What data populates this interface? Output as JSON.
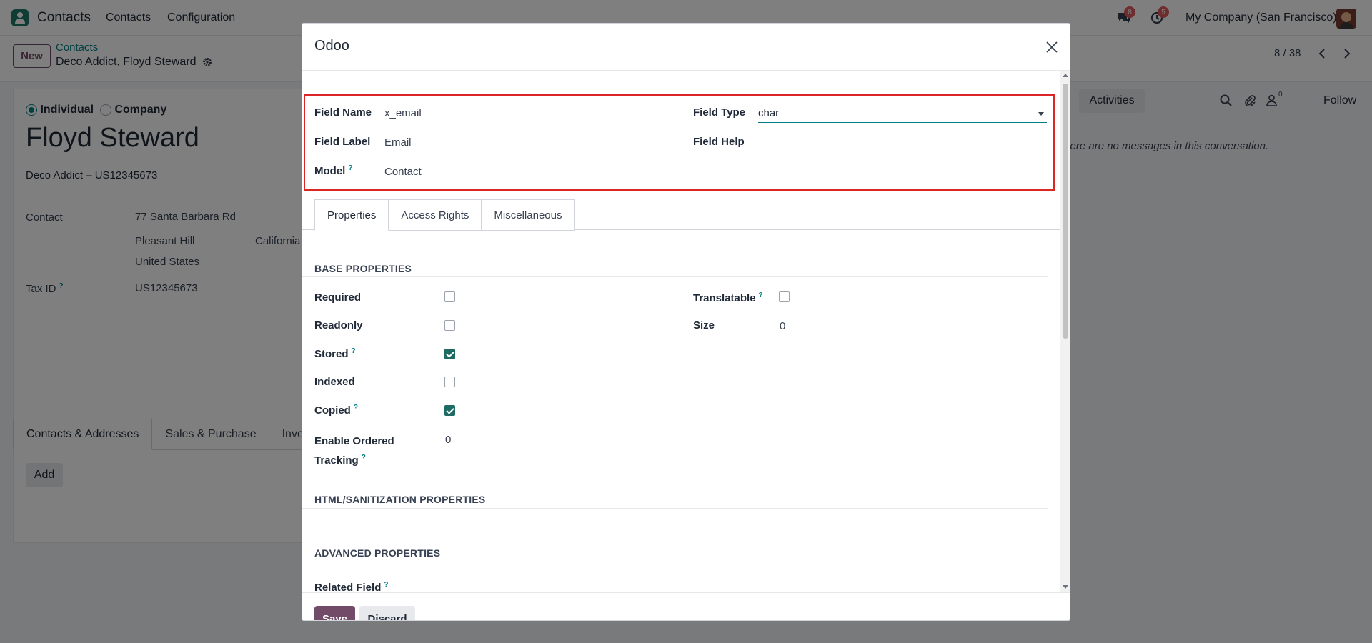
{
  "navbar": {
    "app_name": "Contacts",
    "menu": [
      "Contacts",
      "Configuration"
    ],
    "messages_count": "8",
    "activities_count": "5",
    "company": "My Company (San Francisco)"
  },
  "control_panel": {
    "new_label": "New",
    "breadcrumb_parent": "Contacts",
    "breadcrumb_current": "Deco Addict, Floyd Steward",
    "pager": "8 / 38"
  },
  "record": {
    "type_individual": "Individual",
    "type_company": "Company",
    "name": "Floyd Steward",
    "subtitle": "Deco Addict – US12345673",
    "contact_label": "Contact",
    "street": "77 Santa Barbara Rd",
    "city": "Pleasant Hill",
    "state": "California",
    "country": "United States",
    "tax_label": "Tax ID",
    "tax_value": "US12345673",
    "tabs": [
      "Contacts & Addresses",
      "Sales & Purchase",
      "Invo"
    ],
    "add_label": "Add"
  },
  "chatter": {
    "activities_label": "Activities",
    "followers_count": "0",
    "follow_label": "Follow",
    "empty_message": "There are no messages in this conversation."
  },
  "modal": {
    "title": "Odoo",
    "field_name_label": "Field Name",
    "field_name_value": "x_email",
    "field_type_label": "Field Type",
    "field_type_value": "char",
    "field_label_label": "Field Label",
    "field_label_value": "Email",
    "field_help_label": "Field Help",
    "model_label": "Model",
    "model_value": "Contact",
    "tabs": [
      "Properties",
      "Access Rights",
      "Miscellaneous"
    ],
    "base_properties_title": "BASE PROPERTIES",
    "required_label": "Required",
    "required": false,
    "readonly_label": "Readonly",
    "readonly": false,
    "stored_label": "Stored",
    "stored": true,
    "indexed_label": "Indexed",
    "indexed": false,
    "copied_label": "Copied",
    "copied": true,
    "ordered_tracking_label_1": "Enable Ordered",
    "ordered_tracking_label_2": "Tracking",
    "ordered_tracking_value": "0",
    "translatable_label": "Translatable",
    "translatable": false,
    "size_label": "Size",
    "size_value": "0",
    "html_section_title": "HTML/SANITIZATION PROPERTIES",
    "advanced_section_title": "ADVANCED PROPERTIES",
    "related_field_label": "Related Field",
    "help_mark": "?",
    "save_label": "Save",
    "discard_label": "Discard"
  },
  "colors": {
    "brand": "#714b67",
    "accent": "#017e84",
    "highlight": "#dc2626",
    "badge": "#e05a5a"
  }
}
